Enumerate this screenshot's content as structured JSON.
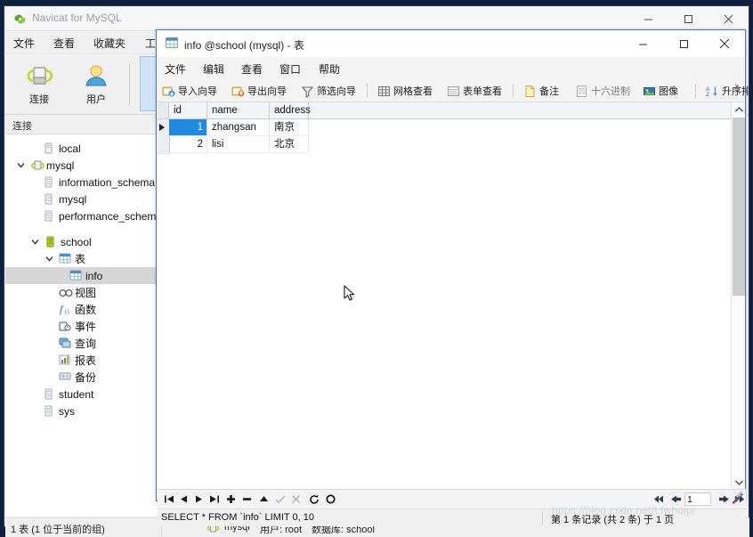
{
  "main_window": {
    "title": "Navicat for MySQL",
    "controls": {
      "minimize": "–",
      "maximize": "□",
      "close": "✕"
    },
    "menu": [
      "文件",
      "查看",
      "收藏夹",
      "工具"
    ],
    "toolbar": [
      {
        "label": "连接",
        "icon": "connection-icon"
      },
      {
        "label": "用户",
        "icon": "user-icon"
      }
    ]
  },
  "sidebar": {
    "header": "连接",
    "items": [
      {
        "label": "local",
        "icon": "server-icon",
        "indent": 0,
        "twisty": "none",
        "selected": false
      },
      {
        "label": "mysql",
        "icon": "connection-green-icon",
        "indent": 0,
        "twisty": "open",
        "selected": false
      },
      {
        "label": "information_schema",
        "icon": "database-icon",
        "indent": 1,
        "twisty": "none",
        "selected": false
      },
      {
        "label": "mysql",
        "icon": "database-icon",
        "indent": 1,
        "twisty": "none",
        "selected": false
      },
      {
        "label": "performance_schema",
        "icon": "database-icon",
        "indent": 1,
        "twisty": "none",
        "selected": false
      },
      {
        "label": "school",
        "icon": "database-open-icon",
        "indent": 1,
        "twisty": "open",
        "selected": false
      },
      {
        "label": "表",
        "icon": "table-folder-icon",
        "indent": 2,
        "twisty": "open",
        "selected": false
      },
      {
        "label": "info",
        "icon": "table-icon",
        "indent": 3,
        "twisty": "none",
        "selected": true
      },
      {
        "label": "视图",
        "icon": "view-icon",
        "indent": 2,
        "twisty": "none",
        "selected": false
      },
      {
        "label": "函数",
        "icon": "function-icon",
        "indent": 2,
        "twisty": "none",
        "selected": false
      },
      {
        "label": "事件",
        "icon": "event-icon",
        "indent": 2,
        "twisty": "none",
        "selected": false
      },
      {
        "label": "查询",
        "icon": "query-icon",
        "indent": 2,
        "twisty": "none",
        "selected": false
      },
      {
        "label": "报表",
        "icon": "report-icon",
        "indent": 2,
        "twisty": "none",
        "selected": false
      },
      {
        "label": "备份",
        "icon": "backup-icon",
        "indent": 2,
        "twisty": "none",
        "selected": false
      },
      {
        "label": "student",
        "icon": "database-icon",
        "indent": 1,
        "twisty": "none",
        "selected": false
      },
      {
        "label": "sys",
        "icon": "database-icon",
        "indent": 1,
        "twisty": "none",
        "selected": false
      }
    ]
  },
  "main_status": {
    "left": "1 表 (1 位于当前的组)",
    "connection": "mysql",
    "user": "用户: root",
    "database": "数据库: school"
  },
  "child_window": {
    "title": "info @school (mysql) - 表",
    "controls": {
      "minimize": "–",
      "maximize": "□",
      "close": "✕"
    },
    "menu": [
      "文件",
      "编辑",
      "查看",
      "窗口",
      "帮助"
    ],
    "toolbar": [
      {
        "label": "导入向导",
        "icon": "import-wizard-icon"
      },
      {
        "label": "导出向导",
        "icon": "export-wizard-icon"
      },
      {
        "label": "筛选向导",
        "icon": "filter-wizard-icon"
      },
      {
        "label": "网格查看",
        "icon": "grid-view-icon"
      },
      {
        "label": "表单查看",
        "icon": "form-view-icon"
      },
      {
        "label": "备注",
        "icon": "memo-icon"
      },
      {
        "label": "十六进制",
        "icon": "hex-icon"
      },
      {
        "label": "图像",
        "icon": "image-icon"
      },
      {
        "label": "升序排序",
        "icon": "sort-asc-icon"
      }
    ],
    "overflow": "»"
  },
  "grid": {
    "columns": [
      "id",
      "name",
      "address"
    ],
    "rows": [
      {
        "id": "1",
        "name": "zhangsan",
        "address": "南京",
        "current": true
      },
      {
        "id": "2",
        "name": "lisi",
        "address": "北京",
        "current": false
      }
    ]
  },
  "nav_bar": {
    "buttons": [
      {
        "name": "first-record-button",
        "glyph": "first"
      },
      {
        "name": "previous-record-button",
        "glyph": "prev"
      },
      {
        "name": "next-record-button",
        "glyph": "next"
      },
      {
        "name": "last-record-button",
        "glyph": "last"
      },
      {
        "name": "add-record-button",
        "glyph": "plus"
      },
      {
        "name": "delete-record-button",
        "glyph": "minus"
      },
      {
        "name": "apply-change-button",
        "glyph": "up"
      },
      {
        "name": "confirm-button",
        "glyph": "check"
      },
      {
        "name": "cancel-button",
        "glyph": "cross"
      },
      {
        "name": "refresh-button",
        "glyph": "refresh"
      },
      {
        "name": "stop-button",
        "glyph": "stop"
      }
    ],
    "page_first": "first-page-button",
    "page_prev": "previous-page-button",
    "page_value": "1",
    "page_next": "next-page-button",
    "page_last": "last-page-button",
    "tools": "tools-button"
  },
  "child_status": {
    "sql": "SELECT * FROM `info` LIMIT 0, 10",
    "record_info": "第 1 条记录 (共 2 条) 于 1 页"
  },
  "watermark": "https://blog.csdn.net/Lfwhoipi",
  "colors": {
    "selection_blue": "#1f8ae0",
    "tree_selection": "#d6d6d6",
    "window_border": "#4a7cb5",
    "desktop": "#102040"
  }
}
